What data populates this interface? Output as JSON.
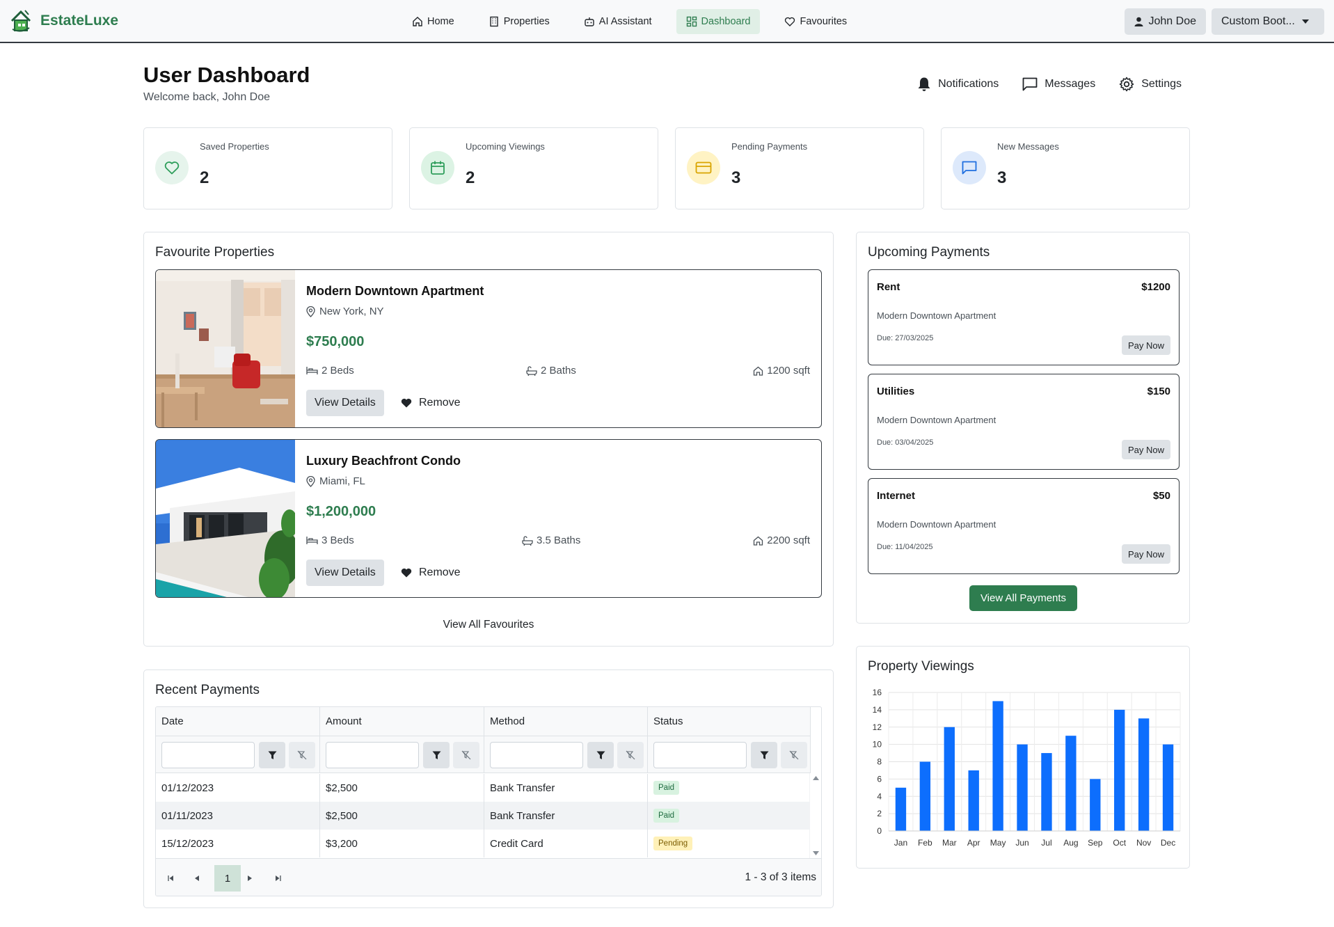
{
  "brand": {
    "name": "EstateLuxe"
  },
  "nav": {
    "links": [
      {
        "label": "Home",
        "icon": "home-icon"
      },
      {
        "label": "Properties",
        "icon": "building-icon"
      },
      {
        "label": "AI Assistant",
        "icon": "robot-icon"
      },
      {
        "label": "Dashboard",
        "icon": "dashboard-icon",
        "active": true
      },
      {
        "label": "Favourites",
        "icon": "heart-icon"
      }
    ],
    "user": "John Doe",
    "theme_select": "Custom Boot..."
  },
  "header": {
    "title": "User Dashboard",
    "subtitle": "Welcome back, John Doe",
    "actions": [
      "Notifications",
      "Messages",
      "Settings"
    ]
  },
  "stats": [
    {
      "label": "Saved Properties",
      "value": "2",
      "icon": "heart-icon",
      "color": "#2e9e5b",
      "bg": "#e6f4ec"
    },
    {
      "label": "Upcoming Viewings",
      "value": "2",
      "icon": "calendar-icon",
      "color": "#2e9e5b",
      "bg": "#dcf3e4"
    },
    {
      "label": "Pending Payments",
      "value": "3",
      "icon": "credit-card-icon",
      "color": "#d9a400",
      "bg": "#fff3c4"
    },
    {
      "label": "New Messages",
      "value": "3",
      "icon": "message-icon",
      "color": "#1f6fe0",
      "bg": "#dde9fb"
    }
  ],
  "favourites": {
    "title": "Favourite Properties",
    "items": [
      {
        "name": "Modern Downtown Apartment",
        "location": "New York, NY",
        "price": "$750,000",
        "beds": "2 Beds",
        "baths": "2 Baths",
        "area": "1200 sqft",
        "view_label": "View Details",
        "remove_label": "Remove"
      },
      {
        "name": "Luxury Beachfront Condo",
        "location": "Miami, FL",
        "price": "$1,200,000",
        "beds": "3 Beds",
        "baths": "3.5 Baths",
        "area": "2200 sqft",
        "view_label": "View Details",
        "remove_label": "Remove"
      }
    ],
    "view_all": "View All Favourites"
  },
  "upcoming_payments": {
    "title": "Upcoming Payments",
    "items": [
      {
        "name": "Rent",
        "amount": "$1200",
        "property": "Modern Downtown Apartment",
        "due": "Due: 27/03/2025",
        "button": "Pay Now"
      },
      {
        "name": "Utilities",
        "amount": "$150",
        "property": "Modern Downtown Apartment",
        "due": "Due: 03/04/2025",
        "button": "Pay Now"
      },
      {
        "name": "Internet",
        "amount": "$50",
        "property": "Modern Downtown Apartment",
        "due": "Due: 11/04/2025",
        "button": "Pay Now"
      }
    ],
    "view_all": "View All Payments"
  },
  "recent_payments": {
    "title": "Recent Payments",
    "columns": [
      "Date",
      "Amount",
      "Method",
      "Status"
    ],
    "rows": [
      {
        "date": "01/12/2023",
        "amount": "$2,500",
        "method": "Bank Transfer",
        "status": "Paid"
      },
      {
        "date": "01/11/2023",
        "amount": "$2,500",
        "method": "Bank Transfer",
        "status": "Paid"
      },
      {
        "date": "15/12/2023",
        "amount": "$3,200",
        "method": "Credit Card",
        "status": "Pending"
      }
    ],
    "pager": {
      "page": "1",
      "info": "1 - 3 of 3 items"
    }
  },
  "viewings": {
    "title": "Property Viewings"
  },
  "chart_data": {
    "type": "bar",
    "categories": [
      "Jan",
      "Feb",
      "Mar",
      "Apr",
      "May",
      "Jun",
      "Jul",
      "Aug",
      "Sep",
      "Oct",
      "Nov",
      "Dec"
    ],
    "values": [
      5,
      8,
      12,
      7,
      15,
      10,
      9,
      11,
      6,
      14,
      13,
      10
    ],
    "yticks": [
      "0",
      "2",
      "4",
      "6",
      "8",
      "10",
      "12",
      "14",
      "16"
    ],
    "ylim": [
      0,
      16
    ],
    "grid": true,
    "color": "#0d6efd"
  }
}
